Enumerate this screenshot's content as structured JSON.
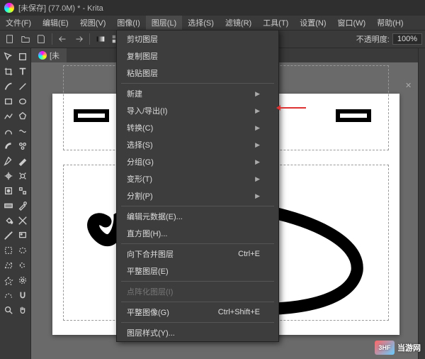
{
  "title": "[未保存] (77.0M) * - Krita",
  "menubar": {
    "items": [
      "文件(F)",
      "编辑(E)",
      "视图(V)",
      "图像(I)",
      "图层(L)",
      "选择(S)",
      "滤镜(R)",
      "工具(T)",
      "设置(N)",
      "窗口(W)",
      "帮助(H)"
    ]
  },
  "toolbar": {
    "opacity_label": "不透明度:",
    "opacity_value": "100%"
  },
  "tab": {
    "label": "[未"
  },
  "dropdown": {
    "items": [
      {
        "label": "剪切图层",
        "type": "item"
      },
      {
        "label": "复制图层",
        "type": "item"
      },
      {
        "label": "粘贴图层",
        "type": "item"
      },
      {
        "type": "sep"
      },
      {
        "label": "新建",
        "type": "sub"
      },
      {
        "label": "导入/导出(I)",
        "type": "sub",
        "highlight": true
      },
      {
        "label": "转换(C)",
        "type": "sub"
      },
      {
        "label": "选择(S)",
        "type": "sub"
      },
      {
        "label": "分组(G)",
        "type": "sub"
      },
      {
        "label": "变形(T)",
        "type": "sub"
      },
      {
        "label": "分割(P)",
        "type": "sub"
      },
      {
        "type": "sep"
      },
      {
        "label": "编辑元数据(E)...",
        "type": "item"
      },
      {
        "label": "直方图(H)...",
        "type": "item"
      },
      {
        "type": "sep"
      },
      {
        "label": "向下合并图层",
        "shortcut": "Ctrl+E",
        "type": "item"
      },
      {
        "label": "平整图层(E)",
        "type": "item"
      },
      {
        "type": "sep"
      },
      {
        "label": "点阵化图层(I)",
        "type": "item",
        "disabled": true
      },
      {
        "type": "sep"
      },
      {
        "label": "平整图像(G)",
        "shortcut": "Ctrl+Shift+E",
        "type": "item"
      },
      {
        "type": "sep"
      },
      {
        "label": "图层样式(Y)...",
        "type": "item"
      }
    ]
  },
  "watermark": "当游网"
}
